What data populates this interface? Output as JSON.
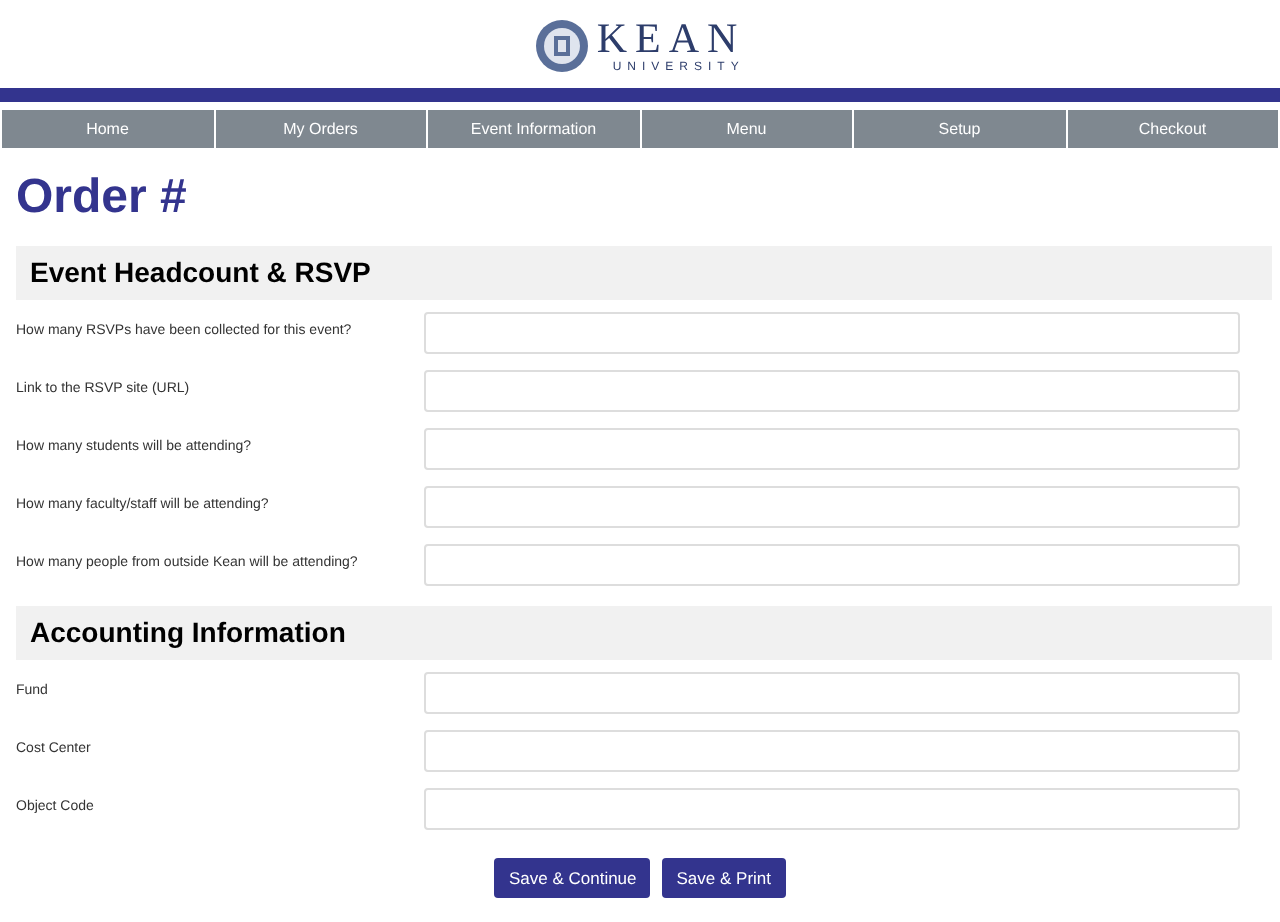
{
  "logo": {
    "wordmark": "KEAN",
    "subtitle": "UNIVERSITY"
  },
  "nav": [
    {
      "label": "Home"
    },
    {
      "label": "My Orders"
    },
    {
      "label": "Event Information"
    },
    {
      "label": "Menu"
    },
    {
      "label": "Setup"
    },
    {
      "label": "Checkout"
    }
  ],
  "title": "Order #",
  "sections": [
    {
      "heading": "Event Headcount & RSVP",
      "fields": [
        {
          "label": "How many RSVPs have been collected for this event?"
        },
        {
          "label": "Link to the RSVP site (URL)"
        },
        {
          "label": "How many students will be attending?"
        },
        {
          "label": "How many faculty/staff will be attending?"
        },
        {
          "label": "How many people from outside Kean will be attending?"
        }
      ]
    },
    {
      "heading": "Accounting Information",
      "fields": [
        {
          "label": "Fund"
        },
        {
          "label": "Cost Center"
        },
        {
          "label": "Object Code"
        }
      ]
    }
  ],
  "buttons": [
    "Save & Continue",
    "Save & Print"
  ]
}
